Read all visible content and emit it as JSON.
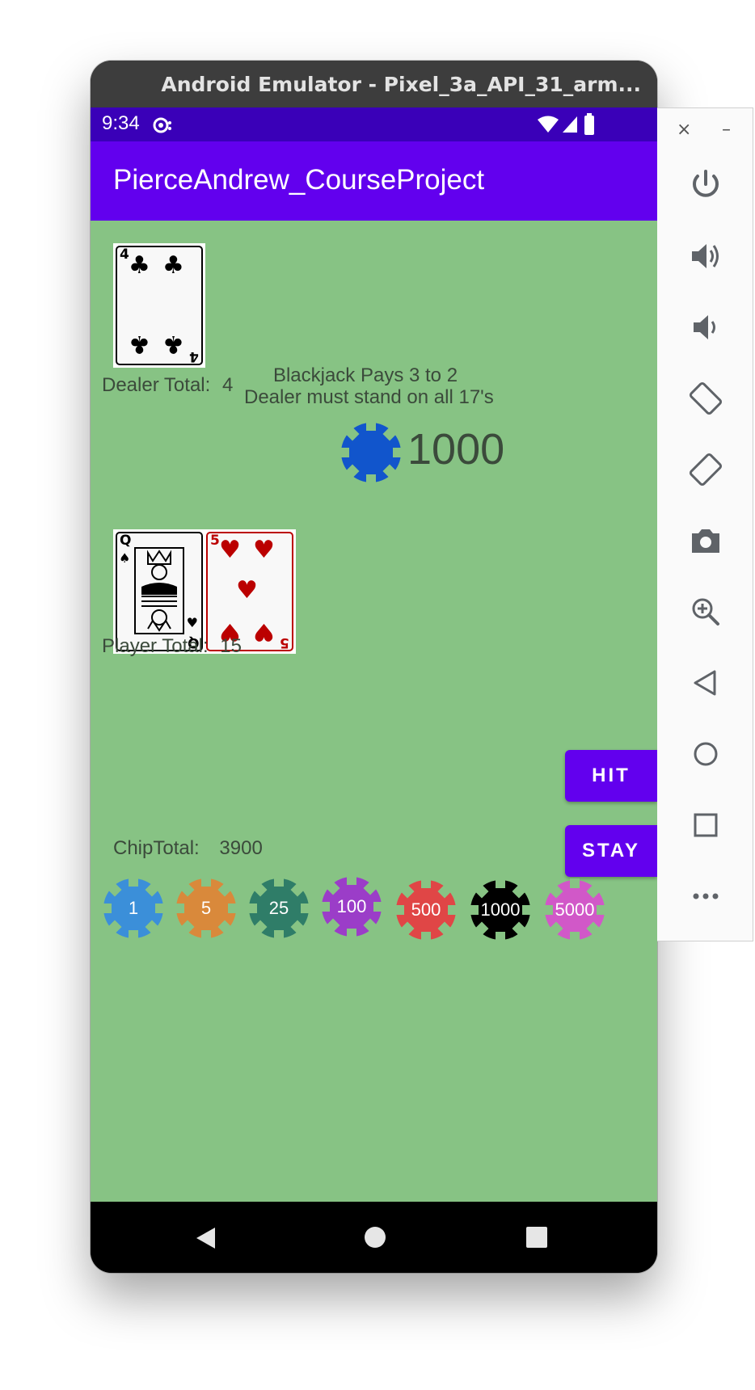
{
  "window": {
    "title": "Android Emulator - Pixel_3a_API_31_arm..."
  },
  "status_bar": {
    "time": "9:34"
  },
  "app_bar": {
    "title": "PierceAndrew_CourseProject"
  },
  "dealer": {
    "cards": [
      {
        "rank": "4",
        "suit": "clubs"
      }
    ],
    "total_label": "Dealer Total:",
    "total_value": "4"
  },
  "rules": {
    "line1": "Blackjack Pays 3 to 2",
    "line2": "Dealer must stand on all 17's"
  },
  "bet": {
    "amount": "1000",
    "chip_color": "#1155cc"
  },
  "player": {
    "cards": [
      {
        "rank": "Q",
        "suit": "spades"
      },
      {
        "rank": "5",
        "suit": "hearts"
      }
    ],
    "total_label": "Player Total:",
    "total_value": "15"
  },
  "actions": {
    "hit_label": "HIT",
    "stay_label": "STAY"
  },
  "chip_total": {
    "label": "ChipTotal:",
    "value": "3900"
  },
  "chips": [
    {
      "value": "1",
      "color": "#3b8fd9"
    },
    {
      "value": "5",
      "color": "#d9893b"
    },
    {
      "value": "25",
      "color": "#2f7d68"
    },
    {
      "value": "100",
      "color": "#9b3dc8"
    },
    {
      "value": "500",
      "color": "#e04646"
    },
    {
      "value": "1000",
      "color": "#000000"
    },
    {
      "value": "5000",
      "color": "#d158c8"
    }
  ],
  "emulator_toolbar": {
    "close": "×",
    "minimize": "–",
    "tools": [
      "power-icon",
      "volume-up-icon",
      "volume-down-icon",
      "rotate-left-icon",
      "rotate-right-icon",
      "camera-icon",
      "zoom-icon",
      "back-icon",
      "home-icon",
      "overview-icon",
      "more-icon"
    ]
  }
}
